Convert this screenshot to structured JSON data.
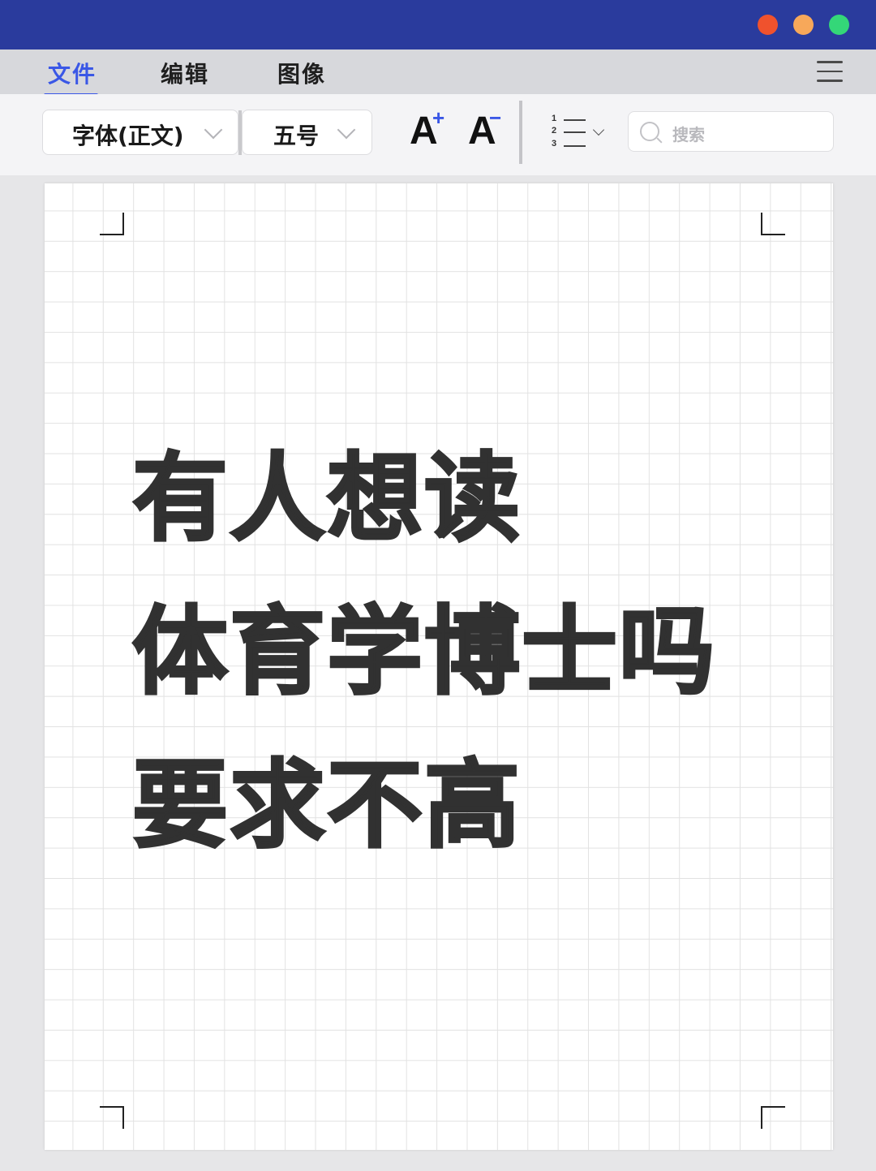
{
  "titlebar": {
    "controls": [
      "close",
      "minimize",
      "maximize"
    ]
  },
  "menubar": {
    "tabs": [
      {
        "label": "文件",
        "active": true
      },
      {
        "label": "编辑",
        "active": false
      },
      {
        "label": "图像",
        "active": false
      }
    ],
    "menu_icon": "hamburger-menu-icon"
  },
  "toolbar": {
    "font_family": "字体(正文)",
    "font_size": "五号",
    "increase_font": {
      "glyph": "A",
      "sup": "+"
    },
    "decrease_font": {
      "glyph": "A",
      "sup": "−"
    },
    "list_numbers": [
      "1",
      "2",
      "3"
    ],
    "search_placeholder": "搜索"
  },
  "document": {
    "lines": [
      "有人想读",
      "体育学博士吗",
      "要求不高"
    ]
  },
  "colors": {
    "titlebar": "#2a3b9d",
    "accent": "#3a57e6",
    "close": "#f0522d",
    "minimize": "#f7a85a",
    "maximize": "#34d778",
    "text": "#313131"
  }
}
